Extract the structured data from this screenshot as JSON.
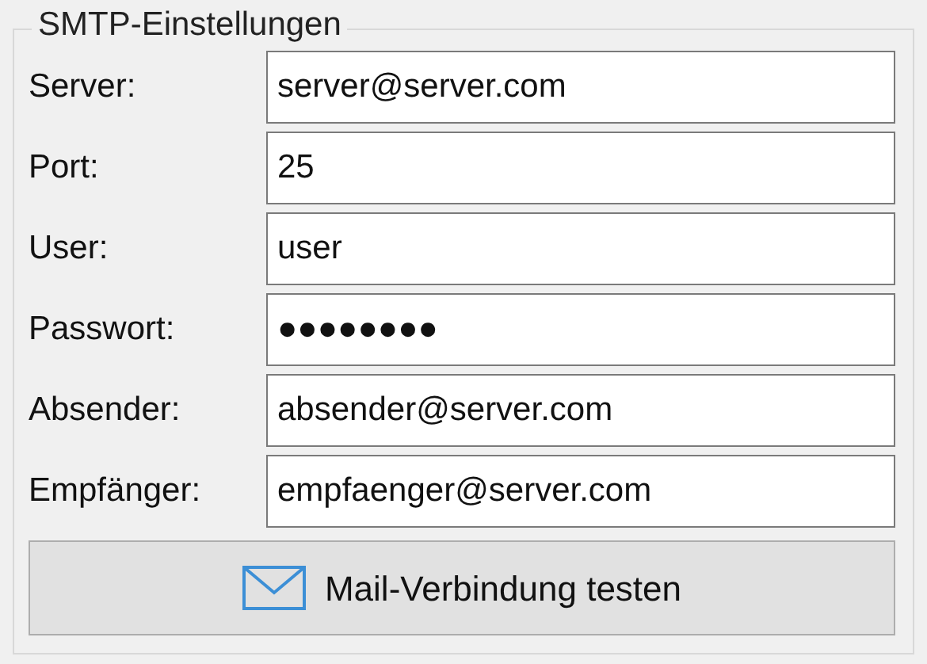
{
  "group": {
    "title": "SMTP-Einstellungen"
  },
  "fields": [
    {
      "label": "Server:",
      "value": "server@server.com"
    },
    {
      "label": "Port:",
      "value": "25"
    },
    {
      "label": "User:",
      "value": "user"
    },
    {
      "label": "Passwort:",
      "value": "●●●●●●●●"
    },
    {
      "label": "Absender:",
      "value": "absender@server.com"
    },
    {
      "label": "Empfänger:",
      "value": "empfaenger@server.com"
    }
  ],
  "button": {
    "label": "Mail-Verbindung testen"
  }
}
